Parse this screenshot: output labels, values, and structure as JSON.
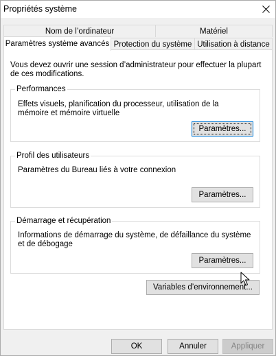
{
  "window": {
    "title": "Propriétés système"
  },
  "tabs": {
    "row1": [
      {
        "label": "Nom de l’ordinateur"
      },
      {
        "label": "Matériel"
      }
    ],
    "row2": [
      {
        "label": "Paramètres système avancés"
      },
      {
        "label": "Protection du système"
      },
      {
        "label": "Utilisation à distance"
      }
    ]
  },
  "main": {
    "intro": "Vous devez ouvrir une session d’administrateur pour effectuer la plupart de ces modifications.",
    "performances": {
      "title": "Performances",
      "desc": "Effets visuels, planification du processeur, utilisation de la mémoire et mémoire virtuelle",
      "button": "Paramètres..."
    },
    "profil": {
      "title": "Profil des utilisateurs",
      "desc": "Paramètres du Bureau liés à votre connexion",
      "button": "Paramètres..."
    },
    "demarrage": {
      "title": "Démarrage et récupération",
      "desc": "Informations de démarrage du système, de défaillance du système et de débogage",
      "button": "Paramètres..."
    },
    "env_button": "Variables d’environnement..."
  },
  "footer": {
    "ok": "OK",
    "cancel": "Annuler",
    "apply": "Appliquer"
  }
}
